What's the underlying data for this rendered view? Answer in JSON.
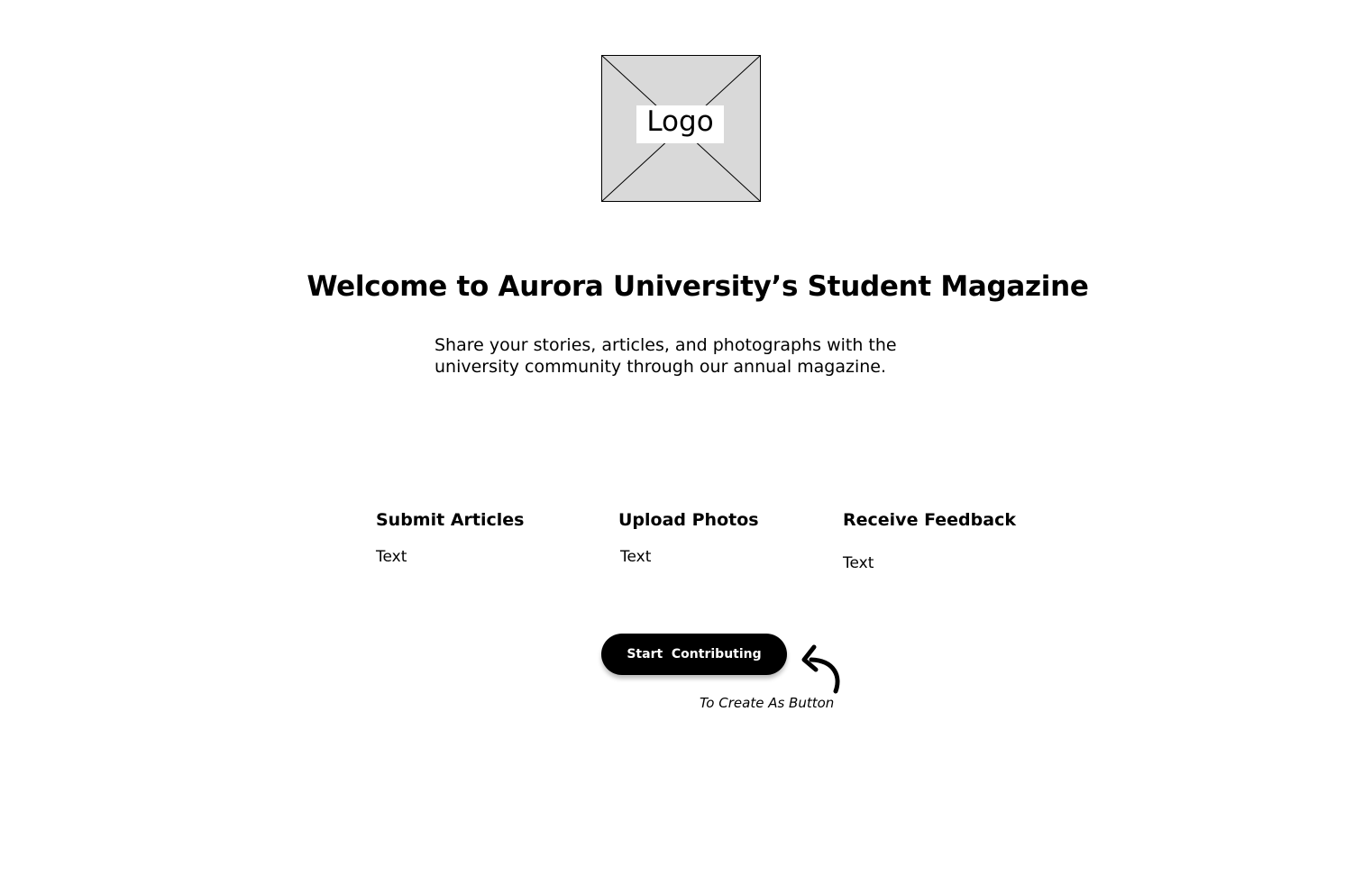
{
  "logo": {
    "label": "Logo"
  },
  "hero": {
    "title": "Welcome to Aurora University’s Student Magazine",
    "description": "Share your stories, articles, and photographs with the university community through our annual magazine."
  },
  "features": [
    {
      "title": "Submit Articles",
      "text": "Text"
    },
    {
      "title": "Upload Photos",
      "text": "Text"
    },
    {
      "title": "Receive Feedback",
      "text": "Text"
    }
  ],
  "cta": {
    "label": "Start  Contributing"
  },
  "annotation": {
    "note": "To Create As Button",
    "icon": "curved-arrow-icon"
  },
  "colors": {
    "placeholder_fill": "#d9d9d9",
    "button_bg": "#000000",
    "button_text": "#ffffff"
  }
}
